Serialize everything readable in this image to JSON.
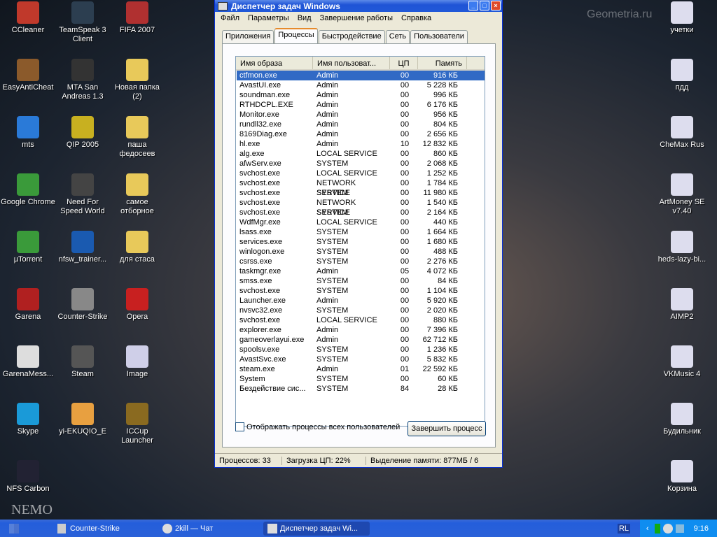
{
  "desktop": {
    "left": [
      {
        "label": "CCleaner",
        "color": "#c0392b"
      },
      {
        "label": "TeamSpeak 3 Client",
        "color": "#2c3e50"
      },
      {
        "label": "FIFA 2007",
        "color": "#b03030"
      },
      {
        "label": "EasyAntiCheat",
        "color": "#8b5a2b"
      },
      {
        "label": "MTA San Andreas 1.3",
        "color": "#333"
      },
      {
        "label": "Новая папка (2)",
        "color": "#e8c95a"
      },
      {
        "label": "mts",
        "color": "#2a7ad8"
      },
      {
        "label": "QIP 2005",
        "color": "#c8b020"
      },
      {
        "label": "паша федосеев",
        "color": "#e8c95a"
      },
      {
        "label": "Google Chrome",
        "color": "#3a9a3a"
      },
      {
        "label": "Need For Speed World",
        "color": "#444"
      },
      {
        "label": "самое отборное",
        "color": "#e8c95a"
      },
      {
        "label": "µTorrent",
        "color": "#3a9a3a"
      },
      {
        "label": "nfsw_trainer...",
        "color": "#1a5ab0"
      },
      {
        "label": "для стаса",
        "color": "#e8c95a"
      },
      {
        "label": "Garena",
        "color": "#b02020"
      },
      {
        "label": "Counter-Strike",
        "color": "#888"
      },
      {
        "label": "Opera",
        "color": "#c82020"
      },
      {
        "label": "GarenaMess...",
        "color": "#ddd"
      },
      {
        "label": "Steam",
        "color": "#555"
      },
      {
        "label": "Image",
        "color": "#cfcfe8"
      },
      {
        "label": "Skype",
        "color": "#1a9ad8"
      },
      {
        "label": "yi-EKUQIO_E",
        "color": "#e8a040"
      },
      {
        "label": "ICCup Launcher",
        "color": "#8a6a20"
      },
      {
        "label": "NFS Carbon",
        "color": "#223"
      }
    ],
    "right": [
      {
        "label": "учетки"
      },
      {
        "label": "пдд"
      },
      {
        "label": "CheMax Rus"
      },
      {
        "label": "ArtMoney SE v7.40"
      },
      {
        "label": "heds-lazy-bi..."
      },
      {
        "label": "AIMP2"
      },
      {
        "label": "VKMusic 4"
      },
      {
        "label": "Будильник"
      },
      {
        "label": "Корзина"
      }
    ]
  },
  "window": {
    "title": "Диспетчер задач Windows",
    "menu": [
      "Файл",
      "Параметры",
      "Вид",
      "Завершение работы",
      "Справка"
    ],
    "tabs": [
      "Приложения",
      "Процессы",
      "Быстродействие",
      "Сеть",
      "Пользователи"
    ],
    "columns": [
      "Имя образа",
      "Имя пользоват...",
      "ЦП",
      "Память"
    ],
    "rows": [
      [
        "ctfmon.exe",
        "Admin",
        "00",
        "916 КБ"
      ],
      [
        "AvastUI.exe",
        "Admin",
        "00",
        "5 228 КБ"
      ],
      [
        "soundman.exe",
        "Admin",
        "00",
        "996 КБ"
      ],
      [
        "RTHDCPL.EXE",
        "Admin",
        "00",
        "6 176 КБ"
      ],
      [
        "Monitor.exe",
        "Admin",
        "00",
        "956 КБ"
      ],
      [
        "rundll32.exe",
        "Admin",
        "00",
        "804 КБ"
      ],
      [
        "8169Diag.exe",
        "Admin",
        "00",
        "2 656 КБ"
      ],
      [
        "hl.exe",
        "Admin",
        "10",
        "12 832 КБ"
      ],
      [
        "alg.exe",
        "LOCAL SERVICE",
        "00",
        "860 КБ"
      ],
      [
        "afwServ.exe",
        "SYSTEM",
        "00",
        "2 068 КБ"
      ],
      [
        "svchost.exe",
        "LOCAL SERVICE",
        "00",
        "1 252 КБ"
      ],
      [
        "svchost.exe",
        "NETWORK SERVICE",
        "00",
        "1 784 КБ"
      ],
      [
        "svchost.exe",
        "SYSTEM",
        "00",
        "11 980 КБ"
      ],
      [
        "svchost.exe",
        "NETWORK SERVICE",
        "00",
        "1 540 КБ"
      ],
      [
        "svchost.exe",
        "SYSTEM",
        "00",
        "2 164 КБ"
      ],
      [
        "WdfMgr.exe",
        "LOCAL SERVICE",
        "00",
        "440 КБ"
      ],
      [
        "lsass.exe",
        "SYSTEM",
        "00",
        "1 664 КБ"
      ],
      [
        "services.exe",
        "SYSTEM",
        "00",
        "1 680 КБ"
      ],
      [
        "winlogon.exe",
        "SYSTEM",
        "00",
        "488 КБ"
      ],
      [
        "csrss.exe",
        "SYSTEM",
        "00",
        "2 276 КБ"
      ],
      [
        "taskmgr.exe",
        "Admin",
        "05",
        "4 072 КБ"
      ],
      [
        "smss.exe",
        "SYSTEM",
        "00",
        "84 КБ"
      ],
      [
        "svchost.exe",
        "SYSTEM",
        "00",
        "1 104 КБ"
      ],
      [
        "Launcher.exe",
        "Admin",
        "00",
        "5 920 КБ"
      ],
      [
        "nvsvc32.exe",
        "SYSTEM",
        "00",
        "2 020 КБ"
      ],
      [
        "svchost.exe",
        "LOCAL SERVICE",
        "00",
        "880 КБ"
      ],
      [
        "explorer.exe",
        "Admin",
        "00",
        "7 396 КБ"
      ],
      [
        "gameoverlayui.exe",
        "Admin",
        "00",
        "62 712 КБ"
      ],
      [
        "spoolsv.exe",
        "SYSTEM",
        "00",
        "1 236 КБ"
      ],
      [
        "AvastSvc.exe",
        "SYSTEM",
        "00",
        "5 832 КБ"
      ],
      [
        "steam.exe",
        "Admin",
        "01",
        "22 592 КБ"
      ],
      [
        "System",
        "SYSTEM",
        "00",
        "60 КБ"
      ],
      [
        "Бездействие сис...",
        "SYSTEM",
        "84",
        "28 КБ"
      ]
    ],
    "show_all_label": "Отображать процессы всех пользователей",
    "end_process_label": "Завершить процесс",
    "status": {
      "processes": "Процессов: 33",
      "cpu": "Загрузка ЦП: 22%",
      "memory": "Выделение памяти: 877МБ / 6"
    }
  },
  "taskbar": {
    "items": [
      "Counter-Strike",
      "2kill — Чат",
      "Диспетчер задач Wi..."
    ],
    "lang": "RL",
    "clock": "9:16"
  },
  "watermark": "Geometria.ru",
  "banner": "NEMO"
}
